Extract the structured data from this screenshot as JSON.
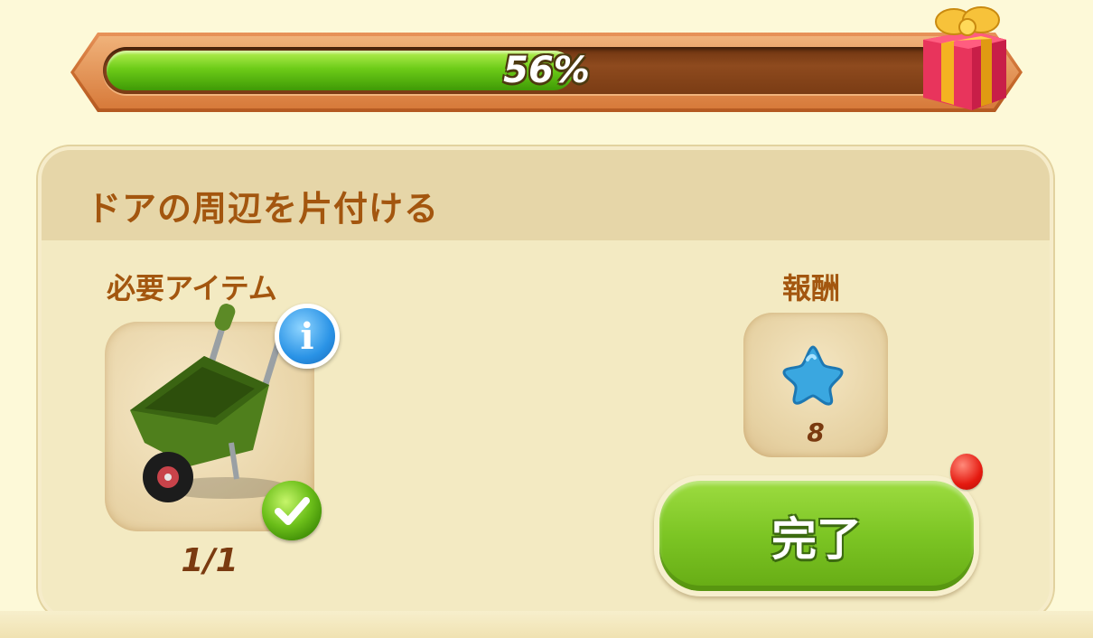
{
  "progress": {
    "percent_label": "56%",
    "fraction": 0.56,
    "reward_icon": "gift-box-icon"
  },
  "quest": {
    "title": "ドアの周辺を片付ける",
    "required": {
      "label": "必要アイテム",
      "item_icon": "wheelbarrow-icon",
      "count": "1/1",
      "info_icon": "info-icon",
      "status_icon": "check-icon"
    },
    "reward": {
      "label": "報酬",
      "icon": "blue-star-icon",
      "amount": "8"
    },
    "complete_button": {
      "label": "完了",
      "notification_icon": "red-notification-dot"
    }
  },
  "colors": {
    "progress_fill": "#6dcc18",
    "label_brown": "#a3560f",
    "button_green": "#7cc524",
    "info_blue": "#2a93e6",
    "notify_red": "#e51a10"
  }
}
